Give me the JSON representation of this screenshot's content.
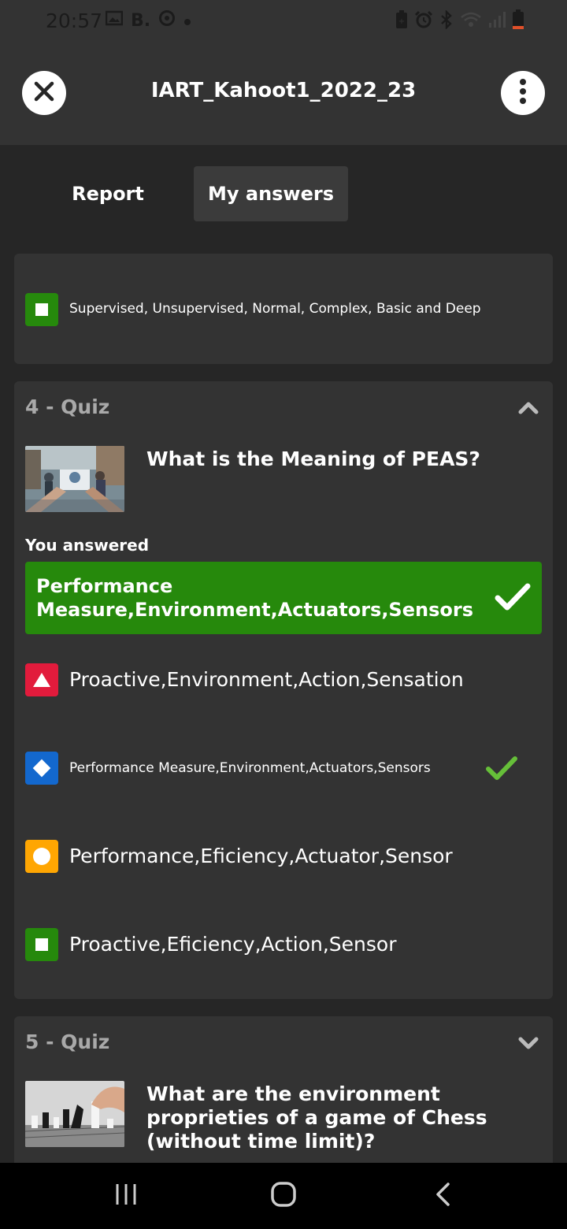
{
  "status_bar": {
    "time": "20:57",
    "left_icons": [
      "image-icon",
      "b-app-icon",
      "sync-app-icon",
      "dot-icon"
    ],
    "right_icons": [
      "battery-saver-icon",
      "alarm-icon",
      "bluetooth-icon",
      "wifi-icon",
      "signal-icon",
      "battery-low-icon"
    ],
    "b_label": "B."
  },
  "header": {
    "title": "IART_Kahoot1_2022_23"
  },
  "tabs": [
    {
      "label": "Report",
      "active": false
    },
    {
      "label": "My answers",
      "active": true
    }
  ],
  "question3_tail": {
    "option_text": "Supervised, Unsupervised, Normal, Complex, Basic and Deep",
    "shape": "square",
    "color": "#26890c"
  },
  "question4": {
    "number_label": "4 - Quiz",
    "expanded": true,
    "question": "What is the Meaning of PEAS?",
    "you_answered_label": "You answered",
    "your_answer": "Performance Measure,Environment,Actuators,Sensors",
    "your_answer_correct": true,
    "options": [
      {
        "shape": "triangle",
        "color": "#e21b3c",
        "text": "Proactive,Environment,Action,Sensation",
        "correct": false
      },
      {
        "shape": "diamond",
        "color": "#1368ce",
        "text": "Performance Measure,Environment,Actuators,Sensors",
        "correct": true
      },
      {
        "shape": "circle",
        "color": "#ffa602",
        "text": "Performance,Eficiency,Actuator,Sensor",
        "correct": false
      },
      {
        "shape": "square",
        "color": "#26890c",
        "text": "Proactive,Eficiency,Action,Sensor",
        "correct": false
      }
    ]
  },
  "question5": {
    "number_label": "5 - Quiz",
    "expanded": false,
    "question": "What are the environment proprieties of a game of Chess (without time limit)?"
  },
  "nav_bar": {
    "buttons": [
      "recent-apps-icon",
      "home-icon",
      "back-icon"
    ]
  }
}
